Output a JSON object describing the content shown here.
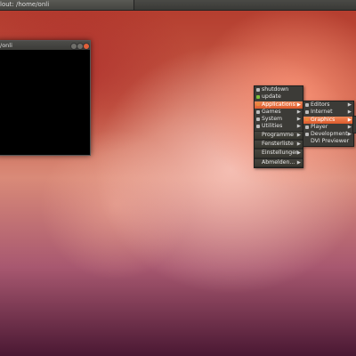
{
  "topbar": {
    "title": "lout: /home/onli"
  },
  "terminal": {
    "title": "/onli"
  },
  "menu": {
    "items": [
      {
        "label": "shutdown",
        "icon": "gear-icon"
      },
      {
        "label": "update",
        "icon": "update-icon"
      },
      {
        "label": "Applications",
        "icon": "folder-icon"
      },
      {
        "label": "Games",
        "icon": "folder-icon"
      },
      {
        "label": "System",
        "icon": "folder-icon"
      },
      {
        "label": "Utilities",
        "icon": "folder-icon"
      },
      {
        "label": "Programme",
        "icon": ""
      },
      {
        "label": "Fensterliste",
        "icon": ""
      },
      {
        "label": "Einstellungen",
        "icon": ""
      },
      {
        "label": "Abmelden...",
        "icon": ""
      }
    ]
  },
  "submenu": {
    "items": [
      {
        "label": "Editors",
        "icon": "folder-icon"
      },
      {
        "label": "Internet",
        "icon": "folder-icon"
      },
      {
        "label": "Graphics",
        "icon": "folder-icon"
      },
      {
        "label": "Player",
        "icon": "folder-icon"
      },
      {
        "label": "Development",
        "icon": "folder-icon"
      },
      {
        "label": "DVI Previewer",
        "icon": ""
      }
    ]
  },
  "colors": {
    "highlight": "#e8703f",
    "menu_bg": "#3c3b37",
    "panel": "#3e3e3a"
  }
}
